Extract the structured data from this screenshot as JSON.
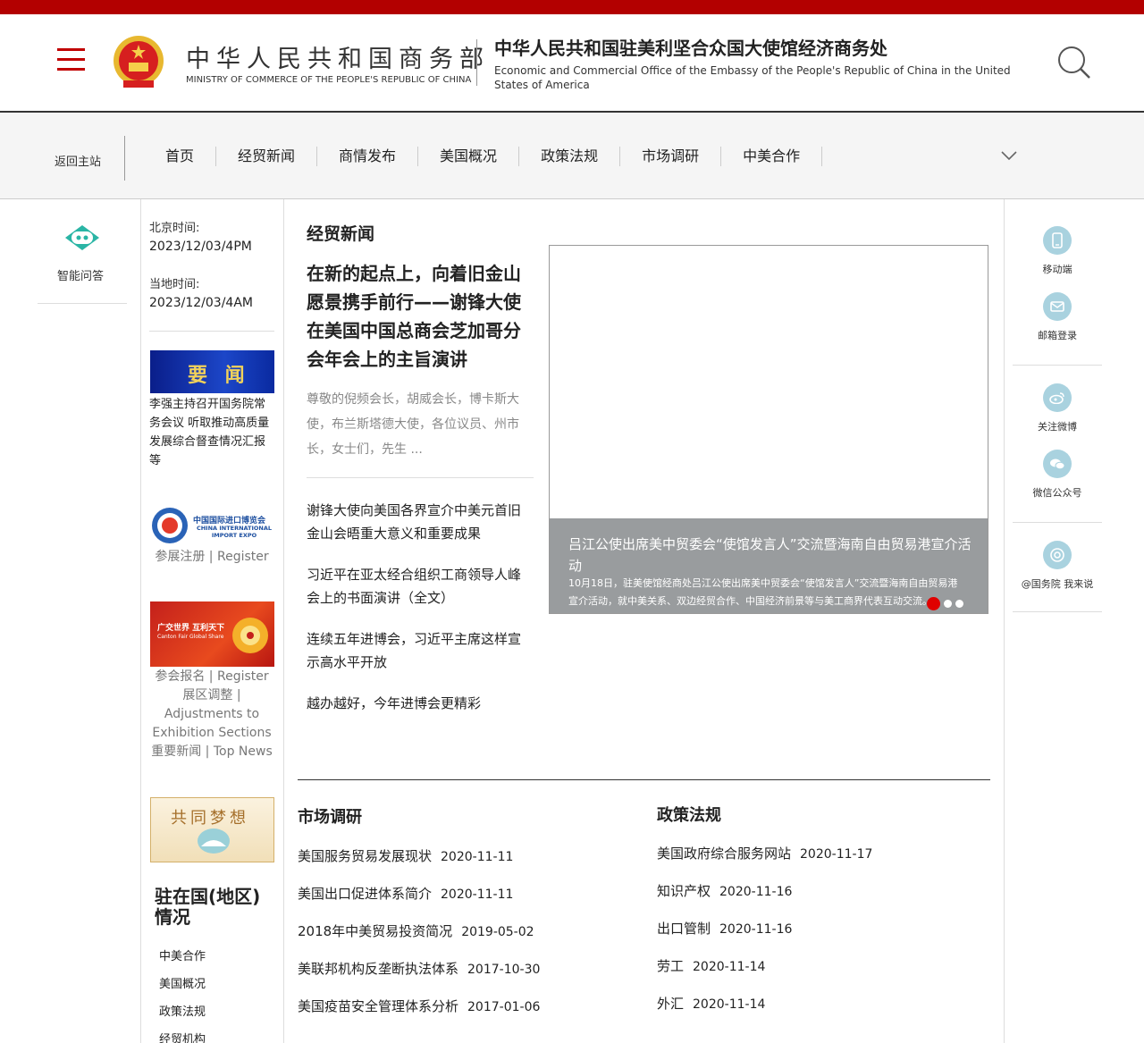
{
  "header": {
    "mofcom_cn": "中华人民共和国商务部",
    "mofcom_en": "MINISTRY OF COMMERCE OF THE PEOPLE'S REPUBLIC OF CHINA",
    "embassy_cn": "中华人民共和国驻美利坚合众国大使馆经济商务处",
    "embassy_en": "Economic and Commercial Office of the Embassy of the People's Republic of China in the United States of America"
  },
  "nav": {
    "back": "返回主站",
    "items": [
      "首页",
      "经贸新闻",
      "商情发布",
      "美国概况",
      "政策法规",
      "市场调研",
      "中美合作"
    ]
  },
  "left": {
    "qa_label": "智能问答",
    "beijing_label": "北京时间:",
    "beijing_time": "2023/12/03/4PM",
    "local_label": "当地时间:",
    "local_time": "2023/12/03/4AM",
    "yaowen_banner": "要 闻",
    "yaowen_text": "李强主持召开国务院常务会议 听取推动高质量发展综合督查情况汇报等",
    "ciie_cn": "中国国际进口博览会",
    "ciie_en": "CHINA INTERNATIONAL IMPORT EXPO",
    "ciie_register": "参展注册 | Register",
    "canton_banner": "广交世界 互利天下",
    "canton_banner_en": "Canton Fair Global Share",
    "canton_register": "参会报名 | Register",
    "canton_adjust": "展区调整 | Adjustments to Exhibition Sections",
    "canton_news": "重要新闻 | Top News",
    "dream_banner": "共同梦想",
    "resident_title": "驻在国(地区)情况",
    "resident_items": [
      "中美合作",
      "美国概况",
      "政策法规",
      "经贸机构"
    ]
  },
  "news": {
    "section_title": "经贸新闻",
    "lead_title": "在新的起点上，向着旧金山愿景携手前行——谢锋大使在美国中国总商会芝加哥分会年会上的主旨演讲",
    "lead_summary": "尊敬的倪频会长，胡威会长，博卡斯大使，布兰斯塔德大使，各位议员、州市长，女士们，先生 ...",
    "items": [
      "谢锋大使向美国各界宣介中美元首旧金山会晤重大意义和重要成果",
      "习近平在亚太经合组织工商领导人峰会上的书面演讲（全文）",
      "连续五年进博会，习近平主席这样宣示高水平开放",
      "越办越好，今年进博会更精彩"
    ],
    "slide_title": "吕江公使出席美中贸委会“使馆发言人”交流暨海南自由贸易港宣介活动",
    "slide_desc": "10月18日，驻美使馆经商处吕江公使出席美中贸委会“使馆发言人”交流暨海南自由贸易港宣介活动，就中美关系、双边经贸合作、中国经济前景等与美工商界代表互动交流。"
  },
  "market": {
    "title": "市场调研",
    "items": [
      {
        "text": "美国服务贸易发展现状",
        "date": "2020-11-11"
      },
      {
        "text": "美国出口促进体系简介",
        "date": "2020-11-11"
      },
      {
        "text": "2018年中美贸易投资简况",
        "date": "2019-05-02"
      },
      {
        "text": "美联邦机构反垄断执法体系",
        "date": "2017-10-30"
      },
      {
        "text": "美国疫苗安全管理体系分析",
        "date": "2017-01-06"
      }
    ]
  },
  "policy": {
    "title": "政策法规",
    "items": [
      {
        "text": "美国政府综合服务网站",
        "date": "2020-11-17"
      },
      {
        "text": "知识产权",
        "date": "2020-11-16"
      },
      {
        "text": "出口管制",
        "date": "2020-11-16"
      },
      {
        "text": "劳工",
        "date": "2020-11-14"
      },
      {
        "text": "外汇",
        "date": "2020-11-14"
      }
    ]
  },
  "right": {
    "mobile": "移动端",
    "mail": "邮箱登录",
    "weibo": "关注微博",
    "wechat": "微信公众号",
    "state_council": "@国务院 我来说"
  },
  "colors": {
    "topbar": "#b30000",
    "accent_red": "#c00000",
    "icon_bg": "#a9d2df",
    "caption_bg": "#999c9e"
  }
}
